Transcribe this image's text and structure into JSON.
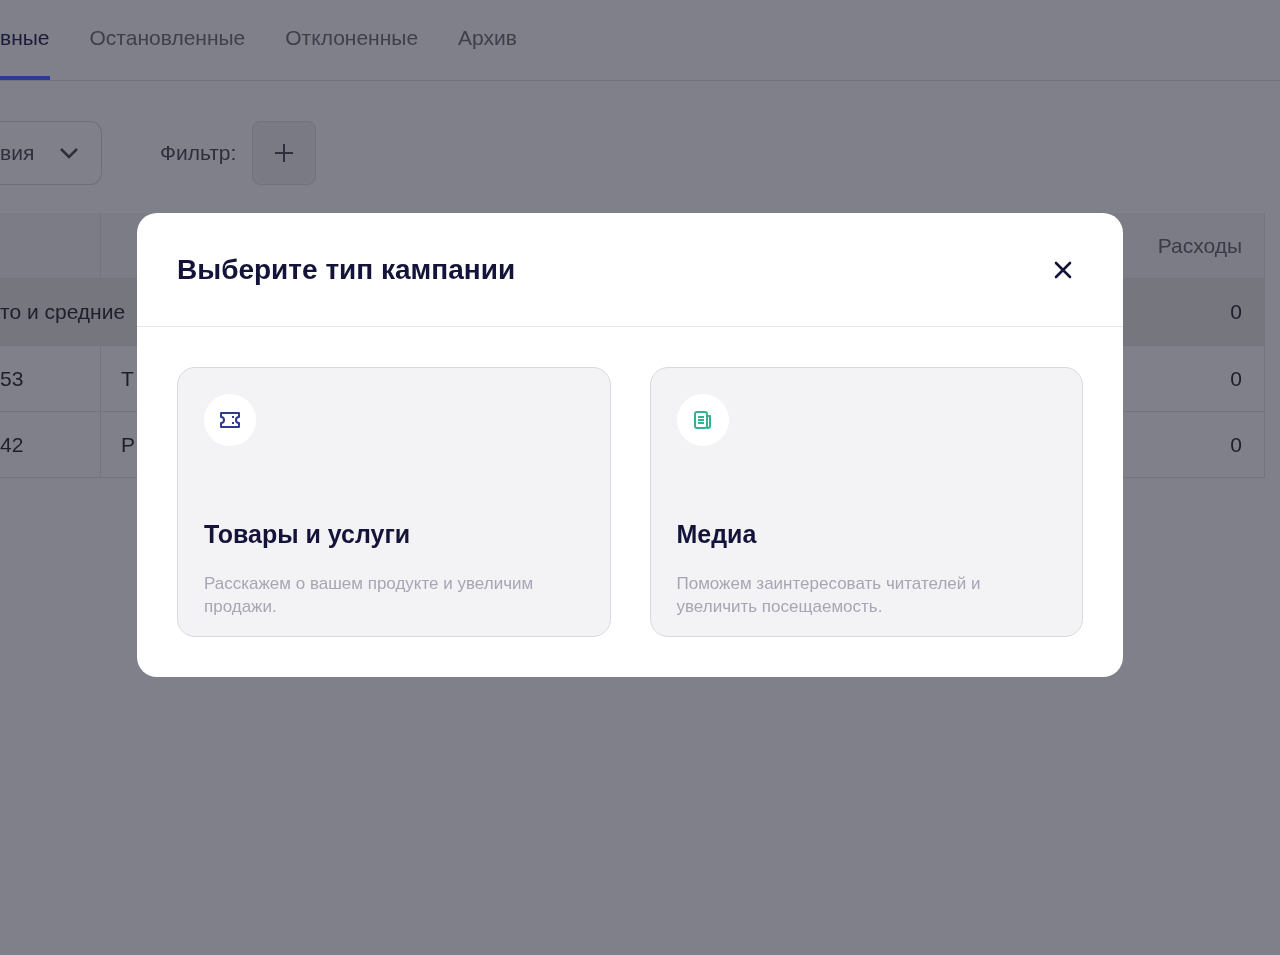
{
  "tabs": [
    {
      "label": "вные",
      "selected": true
    },
    {
      "label": "Остановленные",
      "selected": false
    },
    {
      "label": "Отклоненные",
      "selected": false
    },
    {
      "label": "Архив",
      "selected": false
    }
  ],
  "sort_select": {
    "value": "вия"
  },
  "filter": {
    "label": "Фильтр:"
  },
  "table": {
    "columns": [
      "",
      "",
      "Расходы"
    ],
    "rows": [
      {
        "kind": "group",
        "cells": [
          "то и средние",
          "",
          "0"
        ]
      },
      {
        "kind": "item",
        "cells": [
          "53",
          "Т",
          "0"
        ]
      },
      {
        "kind": "item",
        "cells": [
          "42",
          "Р",
          "0"
        ]
      }
    ]
  },
  "dialog": {
    "title": "Выберите тип кампании",
    "cards": [
      {
        "kind": "goods",
        "title": "Товары и услуги",
        "description": "Расскажем о вашем продукте и увеличим продажи."
      },
      {
        "kind": "media",
        "title": "Медиа",
        "description": "Поможем заинтересовать читателей и увеличить посещаемость."
      }
    ]
  }
}
